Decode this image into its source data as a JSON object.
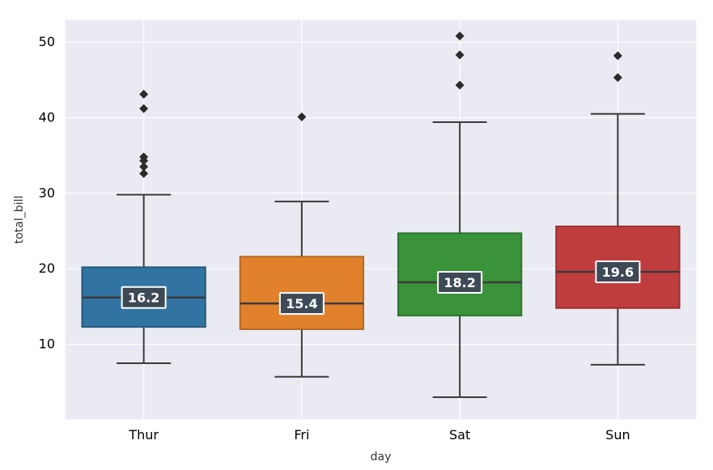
{
  "chart_data": {
    "type": "box",
    "xlabel": "day",
    "ylabel": "total_bill",
    "ylim": [
      0,
      53
    ],
    "yticks": [
      10,
      20,
      30,
      40,
      50
    ],
    "categories": [
      "Thur",
      "Fri",
      "Sat",
      "Sun"
    ],
    "boxes": [
      {
        "category": "Thur",
        "q1": 12.3,
        "median": 16.2,
        "q3": 20.2,
        "whisker_low": 7.5,
        "whisker_high": 29.8,
        "outliers": [
          32.6,
          33.5,
          34.3,
          34.8,
          41.2,
          43.1
        ],
        "color": "#3274a1",
        "edge": "#27597d",
        "annotation": "16.2"
      },
      {
        "category": "Fri",
        "q1": 12.0,
        "median": 15.4,
        "q3": 21.6,
        "whisker_low": 5.7,
        "whisker_high": 28.9,
        "outliers": [
          40.1
        ],
        "color": "#e1812c",
        "edge": "#b56722",
        "annotation": "15.4"
      },
      {
        "category": "Sat",
        "q1": 13.8,
        "median": 18.2,
        "q3": 24.7,
        "whisker_low": 3.0,
        "whisker_high": 39.4,
        "outliers": [
          44.3,
          48.3,
          50.8
        ],
        "color": "#3a923a",
        "edge": "#2f752f",
        "annotation": "18.2"
      },
      {
        "category": "Sun",
        "q1": 14.8,
        "median": 19.6,
        "q3": 25.6,
        "whisker_low": 7.3,
        "whisker_high": 40.5,
        "outliers": [
          45.3,
          48.2
        ],
        "color": "#c03d3e",
        "edge": "#973031",
        "annotation": "19.6"
      }
    ]
  }
}
